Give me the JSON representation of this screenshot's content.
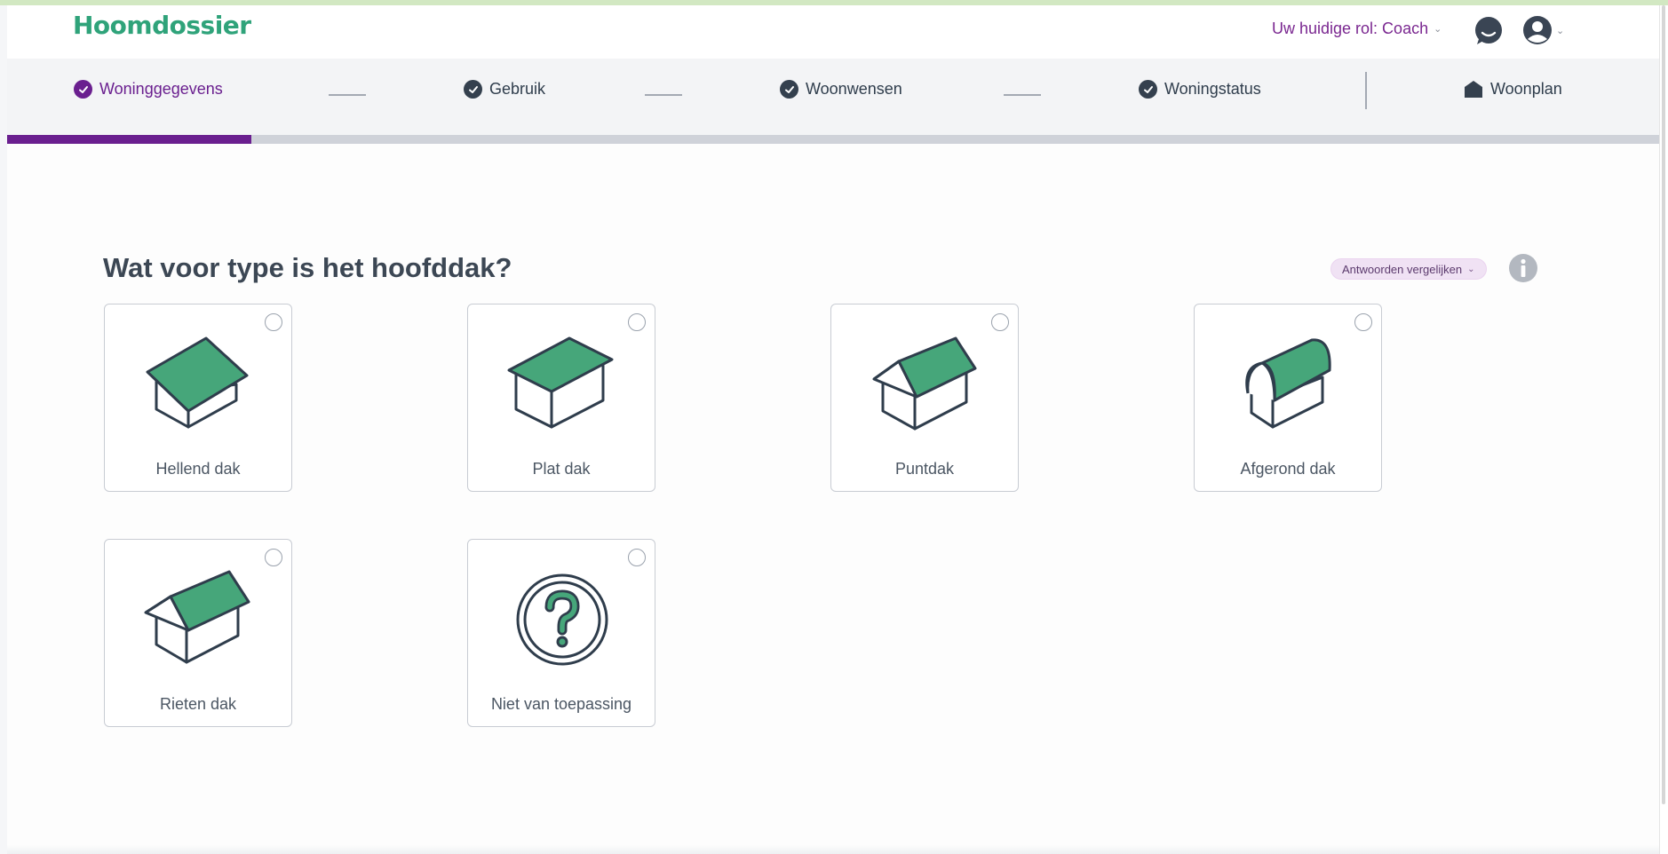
{
  "app": {
    "logo": "Hoomdossier"
  },
  "header": {
    "role_label": "Uw huidige rol: Coach",
    "chat_icon": "chat-bubble-icon",
    "user_icon": "user-circle-icon"
  },
  "steps": [
    {
      "label": "Woninggegevens",
      "icon": "check-circle-icon",
      "active": true
    },
    {
      "label": "Gebruik",
      "icon": "check-circle-icon",
      "active": false
    },
    {
      "label": "Woonwensen",
      "icon": "check-circle-icon",
      "active": false
    },
    {
      "label": "Woningstatus",
      "icon": "check-circle-icon",
      "active": false
    },
    {
      "label": "Woonplan",
      "icon": "house-icon",
      "active": false
    }
  ],
  "progress": {
    "fraction": 0.148,
    "fill_color": "#6a1f8f"
  },
  "question": {
    "title": "Wat voor type is het hoofddak?",
    "compare_label": "Antwoorden vergelijken",
    "info_icon": "info-icon"
  },
  "options": [
    {
      "label": "Hellend dak",
      "icon": "pitched-roof-icon",
      "selected": false
    },
    {
      "label": "Plat dak",
      "icon": "flat-roof-icon",
      "selected": false
    },
    {
      "label": "Puntdak",
      "icon": "gable-roof-icon",
      "selected": false
    },
    {
      "label": "Afgerond dak",
      "icon": "rounded-roof-icon",
      "selected": false
    },
    {
      "label": "Rieten dak",
      "icon": "thatched-roof-icon",
      "selected": false
    },
    {
      "label": "Niet van toepassing",
      "icon": "question-mark-icon",
      "selected": false
    }
  ],
  "colors": {
    "brand_green": "#2fa37a",
    "roof_green": "#46a67a",
    "accent_purple": "#6a1f8f"
  }
}
